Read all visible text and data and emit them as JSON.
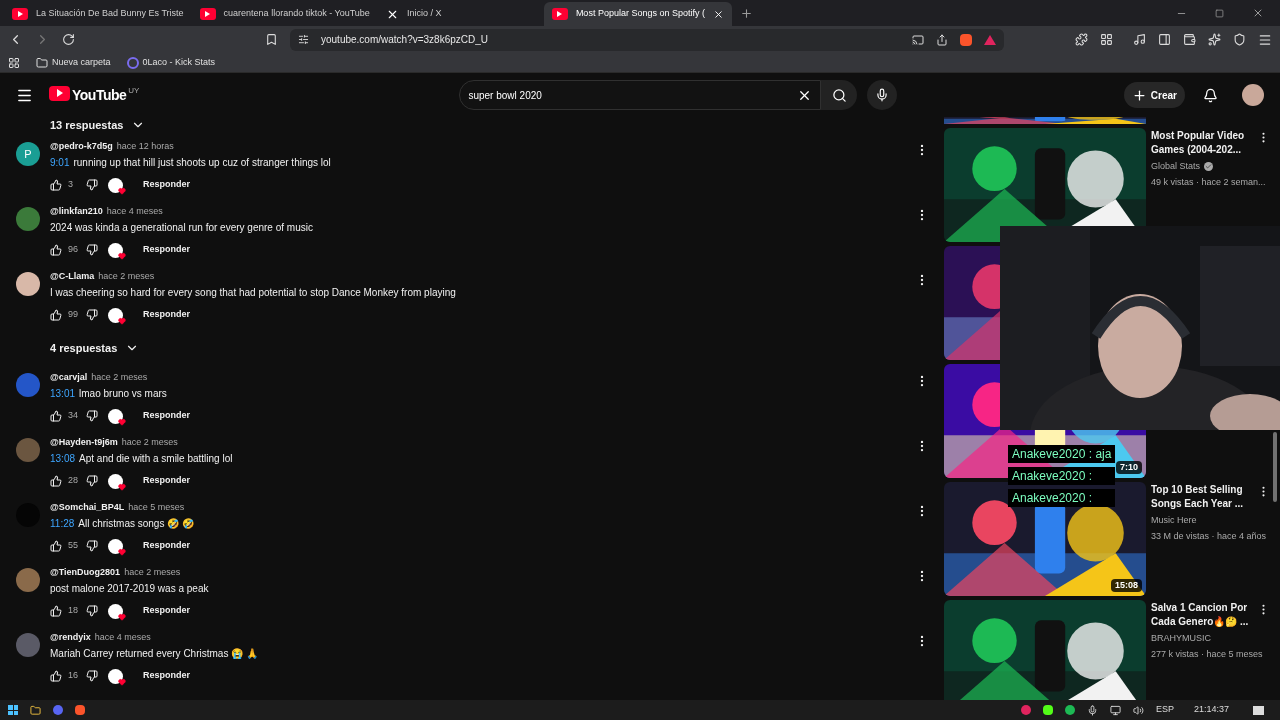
{
  "browser": {
    "tabs": [
      {
        "kind": "youtube",
        "title": "La Situación De Bad Bunny Es Triste",
        "selected": false
      },
      {
        "kind": "youtube",
        "title": "cuarentena llorando tiktok - YouTube",
        "selected": false
      },
      {
        "kind": "x",
        "title": "Inicio / X",
        "selected": false
      },
      {
        "kind": "youtube",
        "title": "Most Popular Songs on Spotify (",
        "selected": true
      }
    ],
    "url": "youtube.com/watch?v=3z8k6pzCD_U",
    "bookmarks": [
      {
        "kind": "folder",
        "label": "Nueva carpeta"
      },
      {
        "kind": "kick",
        "label": "0Laco - Kick Stats"
      }
    ]
  },
  "header": {
    "logo": "YouTube",
    "region": "UY",
    "search_value": "super bowl 2020",
    "create": "Crear"
  },
  "comments": {
    "top_replies": "13 respuestas",
    "items": [
      {
        "kind": "comment",
        "avatar": {
          "letter": "P",
          "color": "#1a9e94"
        },
        "author": "@pedro-k7d5g",
        "time": "hace 12 horas",
        "timestamp": "9:01",
        "text": "running up that hill just shoots up cuz of stranger things lol",
        "likes": "3",
        "reply": "Responder"
      },
      {
        "kind": "comment",
        "avatar": {
          "color": "#3b7a3a"
        },
        "author": "@linkfan210",
        "time": "hace 4 meses",
        "text": "2024 was kinda a generational run for every genre of music",
        "likes": "96",
        "reply": "Responder"
      },
      {
        "kind": "comment",
        "avatar": {
          "color": "#d8b8a8"
        },
        "author": "@C-Llama",
        "time": "hace 2 meses",
        "text": "I was cheering so hard for every song that had potential to stop Dance Monkey from playing",
        "likes": "99",
        "reply": "Responder"
      },
      {
        "kind": "replies",
        "label": "4 respuestas"
      },
      {
        "kind": "comment",
        "avatar": {
          "color": "#2456c8"
        },
        "author": "@carvjal",
        "time": "hace 2 meses",
        "timestamp": "13:01",
        "text": "lmao bruno vs mars",
        "likes": "34",
        "reply": "Responder"
      },
      {
        "kind": "comment",
        "avatar": {
          "color": "#6b5640"
        },
        "author": "@Hayden-t9j6m",
        "time": "hace 2 meses",
        "timestamp": "13:08",
        "text": "Apt and die with a smile battling lol",
        "likes": "28",
        "reply": "Responder"
      },
      {
        "kind": "comment",
        "avatar": {
          "color": "#050505"
        },
        "author": "@Somchai_BP4L",
        "time": "hace 5 meses",
        "timestamp": "11:28",
        "text": "All christmas songs 🤣 🤣",
        "likes": "55",
        "reply": "Responder"
      },
      {
        "kind": "comment",
        "avatar": {
          "color": "#8a6a4a"
        },
        "author": "@TienDuog2801",
        "time": "hace 2 meses",
        "text": "post malone 2017-2019 was a peak",
        "likes": "18",
        "reply": "Responder"
      },
      {
        "kind": "comment",
        "avatar": {
          "color": "#5a5a66"
        },
        "author": "@rendyix",
        "time": "hace 4 meses",
        "text": "Mariah Carrey returned every Christmas 😭 🙏",
        "likes": "16",
        "reply": "Responder"
      }
    ]
  },
  "sidebar": [
    {
      "kind": "strip"
    },
    {
      "kind": "video",
      "title": "Most Popular Video Games (2004-202...",
      "channel": "Global Stats",
      "verified": true,
      "meta": "49 k vistas · hace 2 seman..."
    },
    {
      "kind": "picture"
    },
    {
      "kind": "picture",
      "duration": "7:10"
    },
    {
      "kind": "video",
      "title": "Top 10 Best Selling Songs Each Year ...",
      "channel": "Music Here",
      "verified": false,
      "meta": "33 M de vistas · hace 4 años",
      "duration": "15:08"
    },
    {
      "kind": "video",
      "title": "Salva 1 Cancion Por Cada Genero🔥🤔 ...",
      "channel": "BRAHYMUSIC",
      "verified": false,
      "meta": "277 k vistas · hace 5 meses"
    }
  ],
  "stream_chat": [
    "Anakeve2020 : aja",
    "Anakeve2020 :",
    "Anakeve2020 :"
  ],
  "taskbar": {
    "language": "ESP",
    "clock": "21:14:37"
  }
}
